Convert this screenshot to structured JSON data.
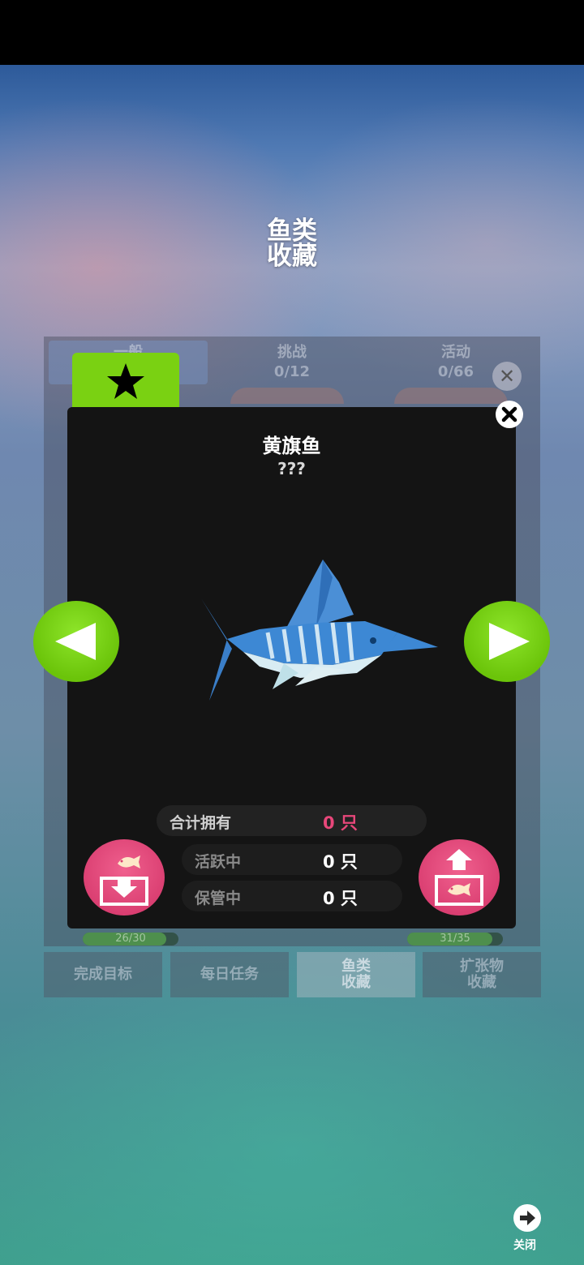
{
  "header": {
    "title_line1": "鱼类",
    "title_line2": "收藏"
  },
  "collection_tabs": [
    {
      "label": "一般",
      "count": ""
    },
    {
      "label": "挑战",
      "count": "0/12"
    },
    {
      "label": "活动",
      "count": "0/66"
    }
  ],
  "progress_bars": [
    {
      "text": "26/30",
      "value": 26,
      "max": 30
    },
    {
      "text": "31/35",
      "value": 31,
      "max": 35
    }
  ],
  "bottom_tabs": [
    {
      "line1": "完成目标",
      "line2": ""
    },
    {
      "line1": "每日任务",
      "line2": ""
    },
    {
      "line1": "鱼类",
      "line2": "收藏"
    },
    {
      "line1": "扩张物",
      "line2": "收藏"
    }
  ],
  "fish_detail": {
    "name": "黄旗鱼",
    "subtitle": "???",
    "stats": {
      "total_label": "合计拥有",
      "total_value": "0 只",
      "active_label": "活跃中",
      "active_value": "0 只",
      "stored_label": "保管中",
      "stored_value": "0 只"
    }
  },
  "footer": {
    "close_label": "关闭"
  },
  "icons": [
    "star-icon",
    "close-icon",
    "prev-arrow-icon",
    "next-arrow-icon",
    "fish-in-icon",
    "fish-out-icon",
    "arrow-right-icon"
  ],
  "colors": {
    "accent_green": "#7ad112",
    "accent_pink": "#e0457a",
    "modal_bg": "#141414"
  }
}
